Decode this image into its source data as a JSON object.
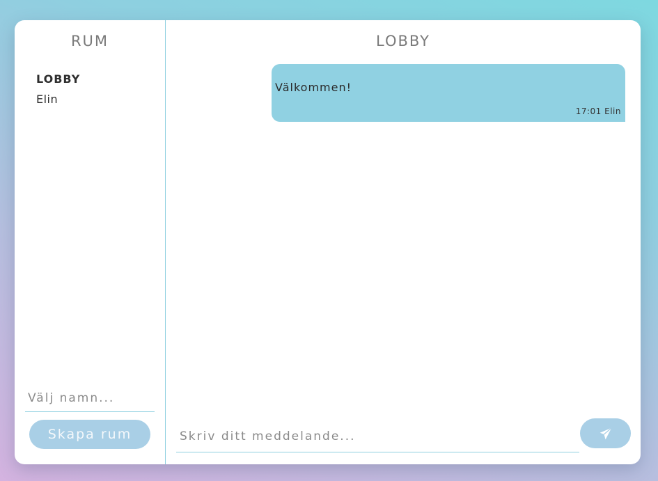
{
  "sidebar": {
    "title": "RUM",
    "rooms": [
      {
        "label": "LOBBY",
        "active": true
      },
      {
        "label": "Elin",
        "active": false
      }
    ],
    "name_input": {
      "placeholder": "Välj namn...",
      "value": ""
    },
    "create_button_label": "Skapa rum"
  },
  "chat": {
    "title": "LOBBY",
    "messages": [
      {
        "text": "Välkommen!",
        "time": "17:01",
        "author": "Elin",
        "meta": "17:01 Elin"
      }
    ],
    "message_input": {
      "placeholder": "Skriv ditt meddelande...",
      "value": ""
    },
    "send_icon": "paper-plane-icon"
  },
  "colors": {
    "accent": "#8fd0e0",
    "bubble": "#90d1e2",
    "button": "#a9cfe6",
    "title_text": "#7a7a7a"
  }
}
